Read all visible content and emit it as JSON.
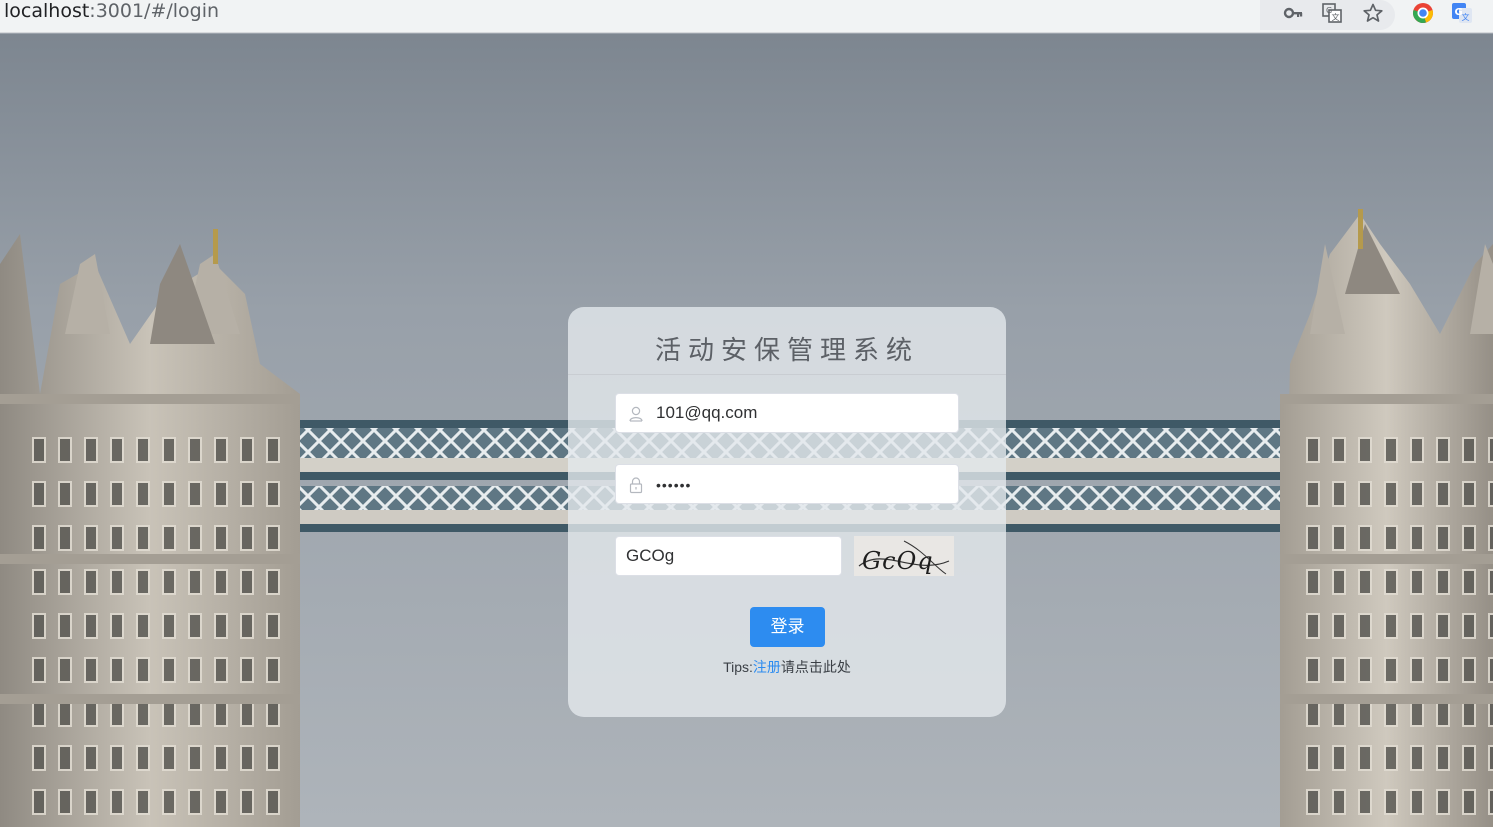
{
  "browser": {
    "url_host": "localhost",
    "url_rest": ":3001/#/login",
    "icons": [
      "key-icon",
      "translate-icon",
      "star-icon",
      "chrome-extension-icon",
      "google-translate-icon"
    ]
  },
  "login": {
    "title": "活动安保管理系统",
    "email_value": "101@qq.com",
    "password_value": "••••••",
    "captcha_value": "GCOg",
    "captcha_image_text": "GcOq",
    "login_button": "登录",
    "tips_prefix": "Tips:",
    "tips_link": "注册",
    "tips_suffix": "请点击此处"
  },
  "colors": {
    "accent": "#2d8cf0",
    "sky": "#9aa1aa"
  }
}
